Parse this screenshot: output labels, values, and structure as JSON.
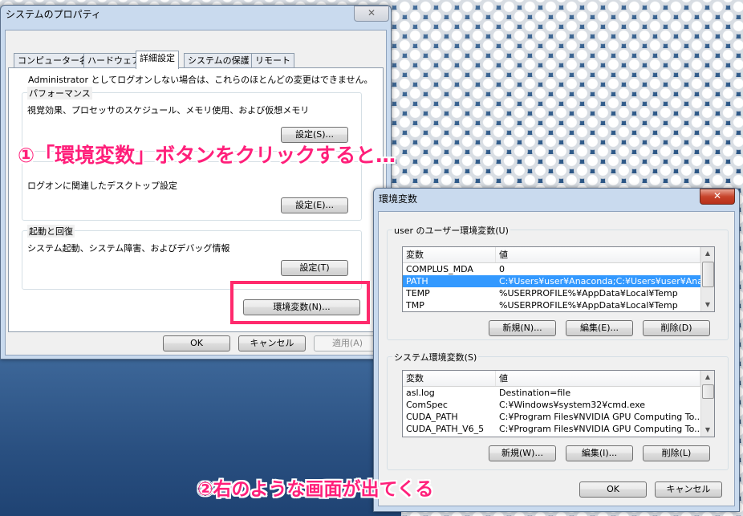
{
  "system_props": {
    "title": "システムのプロパティ",
    "close_label": "✕",
    "tabs": [
      "コンピューター名",
      "ハードウェア",
      "詳細設定",
      "システムの保護",
      "リモート"
    ],
    "active_tab": "詳細設定",
    "admin_note": "Administrator としてログオンしない場合は、これらのほとんどの変更はできません。",
    "performance": {
      "title": "パフォーマンス",
      "desc": "視覚効果、プロセッサのスケジュール、メモリ使用、および仮想メモリ",
      "button": "設定(S)..."
    },
    "user_profile": {
      "desc": "ログオンに関連したデスクトップ設定",
      "button": "設定(E)..."
    },
    "startup": {
      "title": "起動と回復",
      "desc": "システム起動、システム障害、およびデバッグ情報",
      "button": "設定(T)"
    },
    "env_button": "環境変数(N)...",
    "ok": "OK",
    "cancel": "キャンセル",
    "apply": "適用(A)"
  },
  "env_vars": {
    "title": "環境変数",
    "close_label": "✕",
    "user_group_title": "user のユーザー環境変数(U)",
    "system_group_title": "システム環境変数(S)",
    "col_var": "変数",
    "col_val": "値",
    "user_rows": [
      {
        "name": "COMPLUS_MDA",
        "value": "0"
      },
      {
        "name": "PATH",
        "value": "C:¥Users¥user¥Anaconda;C:¥Users¥user¥Ana..."
      },
      {
        "name": "TEMP",
        "value": "%USERPROFILE%¥AppData¥Local¥Temp"
      },
      {
        "name": "TMP",
        "value": "%USERPROFILE%¥AppData¥Local¥Temp"
      }
    ],
    "system_rows": [
      {
        "name": "asl.log",
        "value": "Destination=file"
      },
      {
        "name": "ComSpec",
        "value": "C:¥Windows¥system32¥cmd.exe"
      },
      {
        "name": "CUDA_PATH",
        "value": "C:¥Program Files¥NVIDIA GPU Computing To..."
      },
      {
        "name": "CUDA_PATH_V6_5",
        "value": "C:¥Program Files¥NVIDIA GPU Computing To..."
      }
    ],
    "user_buttons": {
      "new": "新規(N)...",
      "edit": "編集(E)...",
      "delete": "削除(D)"
    },
    "system_buttons": {
      "new": "新規(W)...",
      "edit": "編集(I)...",
      "delete": "削除(L)"
    },
    "ok": "OK",
    "cancel": "キャンセル"
  },
  "annotations": {
    "step1": "①「環境変数」ボタンをクリックすると…",
    "step2": "②右のような画面が出てくる"
  },
  "colors": {
    "annotation": "#ff1f7a",
    "selection": "#3399ff"
  }
}
